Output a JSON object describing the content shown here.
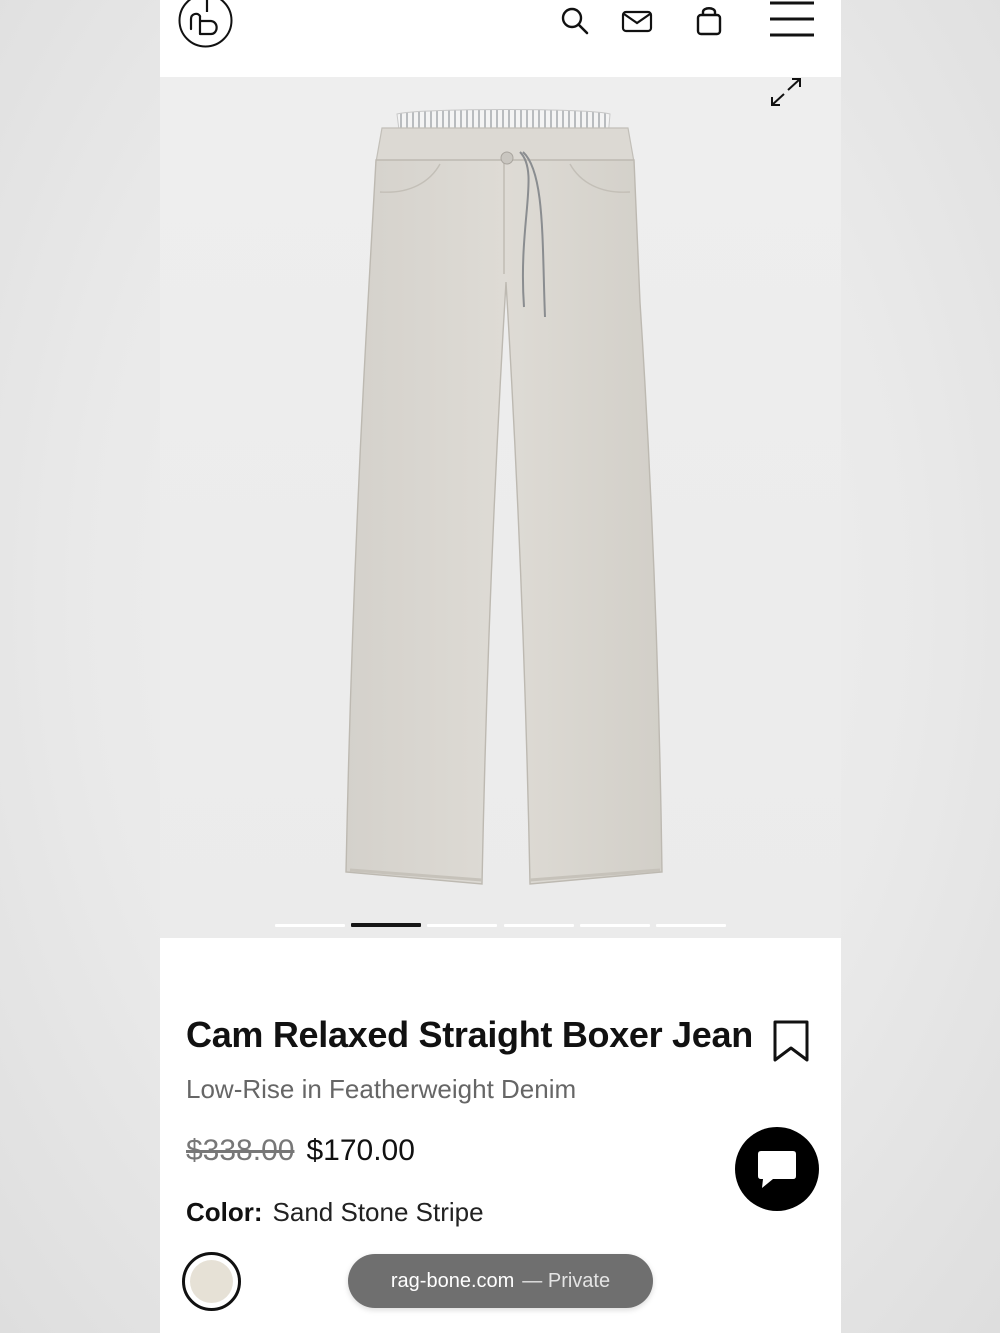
{
  "header": {
    "logo_name": "rag-bone-logo",
    "icons": [
      "search-icon",
      "mail-icon",
      "bag-icon",
      "menu-icon"
    ]
  },
  "gallery": {
    "image_count": 6,
    "active_index": 1,
    "expand_icon": "expand-icon"
  },
  "product": {
    "title": "Cam Relaxed Straight Boxer Jean",
    "subtitle": "Low-Rise in Featherweight Denim",
    "price_original": "$338.00",
    "price_sale": "$170.00",
    "color_label": "Color:",
    "color_value": "Sand Stone Stripe",
    "swatch_color": "#e6e1d6"
  },
  "chat": {
    "icon": "chat-bubble-icon"
  },
  "browser": {
    "domain": "rag-bone.com",
    "mode": "— Private"
  },
  "colors": {
    "accent": "#000000",
    "background": "#ffffff",
    "gallery_bg": "#ededed",
    "muted_text": "#666666"
  }
}
